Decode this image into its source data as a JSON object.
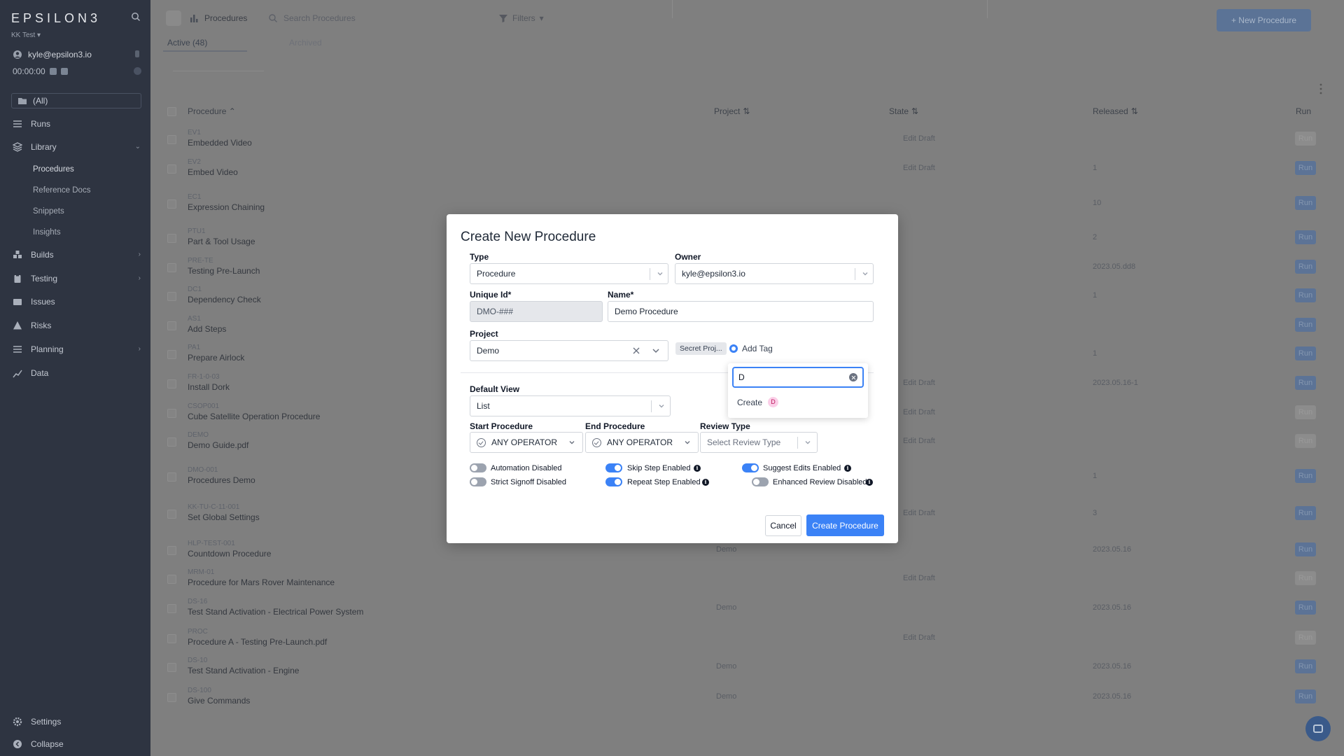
{
  "sidebar": {
    "logo": "EPSILON3",
    "team": "KK Test ▾",
    "user_email": "kyle@epsilon3.io",
    "timer": "00:00:00",
    "all_label": "(All)",
    "nav": [
      {
        "label": "Runs"
      },
      {
        "label": "Library"
      },
      {
        "label": "Procedures"
      },
      {
        "label": "Reference Docs"
      },
      {
        "label": "Snippets"
      },
      {
        "label": "Insights"
      },
      {
        "label": "Builds"
      },
      {
        "label": "Testing"
      },
      {
        "label": "Issues"
      },
      {
        "label": "Risks"
      },
      {
        "label": "Planning"
      },
      {
        "label": "Data"
      }
    ],
    "bottom": [
      {
        "label": "Settings"
      },
      {
        "label": "Collapse"
      }
    ]
  },
  "topbar": {
    "breadcrumb": "Procedures",
    "search_placeholder": "Search Procedures",
    "filters_label": "Filters",
    "new_button": "+ New Procedure"
  },
  "tabs": {
    "active": "Active (48)",
    "archived": "Archived"
  },
  "table": {
    "headers": {
      "procedure": "Procedure ⌃",
      "project": "Project",
      "state": "State",
      "released": "Released",
      "run": "Run"
    },
    "rows": [
      {
        "code": "EV1",
        "name": "Embedded Video",
        "state": "Edit Draft",
        "released": "",
        "project": ""
      },
      {
        "code": "EV2",
        "name": "Embed Video",
        "state": "Edit Draft",
        "released": "1",
        "project": ""
      },
      {
        "code": "EC1",
        "name": "Expression Chaining",
        "state": "",
        "released": "10",
        "project": ""
      },
      {
        "code": "PTU1",
        "name": "Part & Tool Usage",
        "state": "",
        "released": "2",
        "project": ""
      },
      {
        "code": "PRE-TE",
        "name": "Testing Pre-Launch",
        "state": "",
        "released": "2023.05.dd8",
        "project": ""
      },
      {
        "code": "DC1",
        "name": "Dependency Check",
        "state": "",
        "released": "1",
        "project": ""
      },
      {
        "code": "AS1",
        "name": "Add Steps",
        "state": "",
        "released": "",
        "project": ""
      },
      {
        "code": "PA1",
        "name": "Prepare Airlock",
        "state": "",
        "released": "1",
        "project": ""
      },
      {
        "code": "FR-1-0-03",
        "name": "Install Dork",
        "state": "Edit Draft",
        "released": "2023.05.16-1",
        "project": ""
      },
      {
        "code": "CSOP001",
        "name": "Cube Satellite Operation Procedure",
        "state": "Edit Draft",
        "released": "",
        "project": ""
      },
      {
        "code": "DEMO",
        "name": "Demo Guide.pdf",
        "state": "Edit Draft",
        "released": "",
        "project": ""
      },
      {
        "code": "DMO-001",
        "name": "Procedures Demo",
        "state": "",
        "released": "1",
        "project": ""
      },
      {
        "code": "KK-TU-C-11-001",
        "name": "Set Global Settings",
        "state": "Edit Draft",
        "released": "3",
        "project": ""
      },
      {
        "code": "HLP-TEST-001",
        "name": "Countdown Procedure",
        "state": "",
        "released": "2023.05.16",
        "project": "Demo"
      },
      {
        "code": "MRM-01",
        "name": "Procedure for Mars Rover Maintenance",
        "state": "Edit Draft",
        "released": "",
        "project": ""
      },
      {
        "code": "DS-16",
        "name": "Test Stand Activation - Electrical Power System",
        "state": "",
        "released": "2023.05.16",
        "project": "Demo"
      },
      {
        "code": "PROC",
        "name": "Procedure A - Testing Pre-Launch.pdf",
        "state": "Edit Draft",
        "released": "",
        "project": ""
      },
      {
        "code": "DS-10",
        "name": "Test Stand Activation - Engine",
        "state": "",
        "released": "2023.05.16",
        "project": "Demo"
      },
      {
        "code": "DS-100",
        "name": "Give Commands",
        "state": "",
        "released": "2023.05.16",
        "project": "Demo"
      }
    ],
    "run_label": "Run"
  },
  "modal": {
    "title": "Create New Procedure",
    "type_label": "Type",
    "type_value": "Procedure",
    "owner_label": "Owner",
    "owner_value": "kyle@epsilon3.io",
    "unique_id_label": "Unique Id*",
    "unique_id_value": "DMO-###",
    "name_label": "Name*",
    "name_value": "Demo Procedure",
    "project_label": "Project",
    "project_value": "Demo",
    "tag_chip": "Secret Proj...",
    "add_tag": "Add Tag",
    "default_view_label": "Default View",
    "default_view_value": "List",
    "start_label": "Start Procedure",
    "start_value": "ANY OPERATOR",
    "end_label": "End Procedure",
    "end_value": "ANY OPERATOR",
    "review_label": "Review Type",
    "review_placeholder": "Select Review Type",
    "toggles": [
      {
        "label": "Automation Disabled",
        "on": false
      },
      {
        "label": "Strict Signoff Disabled",
        "on": false
      },
      {
        "label": "Skip Step Enabled",
        "on": true
      },
      {
        "label": "Repeat Step Enabled",
        "on": true
      },
      {
        "label": "Suggest Edits Enabled",
        "on": true
      },
      {
        "label": "Enhanced Review Disabled",
        "on": false
      }
    ],
    "cancel": "Cancel",
    "create": "Create Procedure"
  },
  "tag_popup": {
    "input_value": "D",
    "create_label": "Create",
    "create_pill": "D"
  },
  "colors": {
    "accent": "#3b82f6",
    "sidebar_bg": "#2e3441"
  }
}
